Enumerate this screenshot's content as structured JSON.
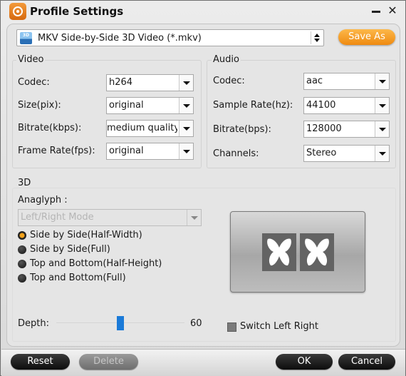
{
  "window": {
    "title": "Profile Settings",
    "minimize_icon": "minimize-icon",
    "close_icon": "close-icon"
  },
  "profile": {
    "icon": "mkv-3d-file-icon",
    "icon_text": "3D",
    "selected": "MKV Side-by-Side 3D Video (*.mkv)",
    "save_as_label": "Save As"
  },
  "video": {
    "title": "Video",
    "fields": [
      {
        "label": "Codec:",
        "value": "h264"
      },
      {
        "label": "Size(pix):",
        "value": "original"
      },
      {
        "label": "Bitrate(kbps):",
        "value": "medium quality"
      },
      {
        "label": "Frame Rate(fps):",
        "value": "original"
      }
    ]
  },
  "audio": {
    "title": "Audio",
    "fields": [
      {
        "label": "Codec:",
        "value": "aac"
      },
      {
        "label": "Sample Rate(hz):",
        "value": "44100"
      },
      {
        "label": "Bitrate(bps):",
        "value": "128000"
      },
      {
        "label": "Channels:",
        "value": "Stereo"
      }
    ]
  },
  "three_d": {
    "title": "3D",
    "anaglyph_label": "Anaglyph :",
    "anaglyph_value": "Left/Right Mode",
    "modes": [
      {
        "label": "Side by Side(Half-Width)",
        "selected": true
      },
      {
        "label": "Side by Side(Full)",
        "selected": false
      },
      {
        "label": "Top and Bottom(Half-Height)",
        "selected": false
      },
      {
        "label": "Top and Bottom(Full)",
        "selected": false
      }
    ],
    "preview_icon": "side-by-side-butterfly-preview",
    "depth_label": "Depth:",
    "depth_value": "60",
    "switch_label": "Switch Left Right",
    "switch_checked": false
  },
  "footer": {
    "reset_label": "Reset",
    "delete_label": "Delete",
    "ok_label": "OK",
    "cancel_label": "Cancel"
  },
  "colors": {
    "accent_orange": "#F39A1E",
    "slider_blue": "#1A7AD8"
  }
}
